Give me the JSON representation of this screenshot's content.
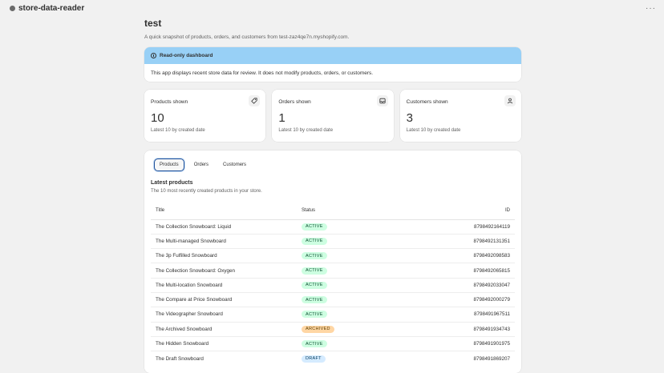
{
  "app": {
    "name": "store-data-reader",
    "more": "···"
  },
  "page": {
    "title": "test",
    "subtitle": "A quick snapshot of products, orders, and customers from test-zaz4qe7n.myshopify.com."
  },
  "banner": {
    "title": "Read-only dashboard",
    "body": "This app displays recent store data for review. It does not modify products, orders, or customers."
  },
  "stats": [
    {
      "label": "Products shown",
      "value": "10",
      "note": "Latest 10 by created date",
      "icon": "tag-icon"
    },
    {
      "label": "Orders shown",
      "value": "1",
      "note": "Latest 10 by created date",
      "icon": "inbox-icon"
    },
    {
      "label": "Customers shown",
      "value": "3",
      "note": "Latest 10 by created date",
      "icon": "person-icon"
    }
  ],
  "tabs": [
    {
      "label": "Products",
      "active": true
    },
    {
      "label": "Orders",
      "active": false
    },
    {
      "label": "Customers",
      "active": false
    }
  ],
  "products": {
    "title": "Latest products",
    "subtitle": "The 10 most recently created products in your store.",
    "columns": {
      "title": "Title",
      "status": "Status",
      "id": "ID"
    },
    "rows": [
      {
        "title": "The Collection Snowboard: Liquid",
        "status": "ACTIVE",
        "id": "8798492164119"
      },
      {
        "title": "The Multi-managed Snowboard",
        "status": "ACTIVE",
        "id": "8798492131351"
      },
      {
        "title": "The 3p Fulfilled Snowboard",
        "status": "ACTIVE",
        "id": "8798492098583"
      },
      {
        "title": "The Collection Snowboard: Oxygen",
        "status": "ACTIVE",
        "id": "8798492065815"
      },
      {
        "title": "The Multi-location Snowboard",
        "status": "ACTIVE",
        "id": "8798492033047"
      },
      {
        "title": "The Compare at Price Snowboard",
        "status": "ACTIVE",
        "id": "8798492000279"
      },
      {
        "title": "The Videographer Snowboard",
        "status": "ACTIVE",
        "id": "8798491967511"
      },
      {
        "title": "The Archived Snowboard",
        "status": "ARCHIVED",
        "id": "8798491934743"
      },
      {
        "title": "The Hidden Snowboard",
        "status": "ACTIVE",
        "id": "8798491901975"
      },
      {
        "title": "The Draft Snowboard",
        "status": "DRAFT",
        "id": "8798491869207"
      }
    ]
  }
}
